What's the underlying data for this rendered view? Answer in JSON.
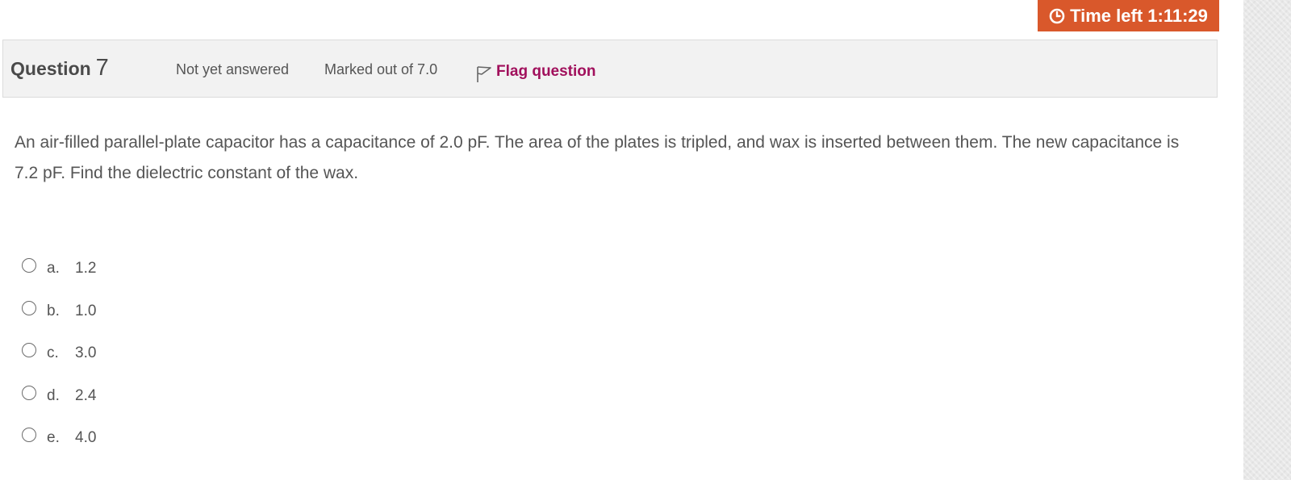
{
  "timer": {
    "icon": "clock-icon",
    "label": "Time left 1:11:29",
    "background": "#d9582b"
  },
  "question": {
    "title_word": "Question",
    "number": "7",
    "status": "Not yet answered",
    "marks": "Marked out of 7.0",
    "flag_label": "Flag question",
    "flag_icon": "flag-outline-icon",
    "flag_color": "#a1105c",
    "text": "An air-filled parallel-plate capacitor has a capacitance of 2.0 pF. The area of the plates is tripled, and wax is inserted between them. The new capacitance is 7.2 pF. Find the dielectric constant of the wax."
  },
  "options": [
    {
      "letter": "a.",
      "value": "1.2",
      "selected": false
    },
    {
      "letter": "b.",
      "value": "1.0",
      "selected": false
    },
    {
      "letter": "c.",
      "value": "3.0",
      "selected": false
    },
    {
      "letter": "d.",
      "value": "2.4",
      "selected": false
    },
    {
      "letter": "e.",
      "value": "4.0",
      "selected": false
    }
  ]
}
